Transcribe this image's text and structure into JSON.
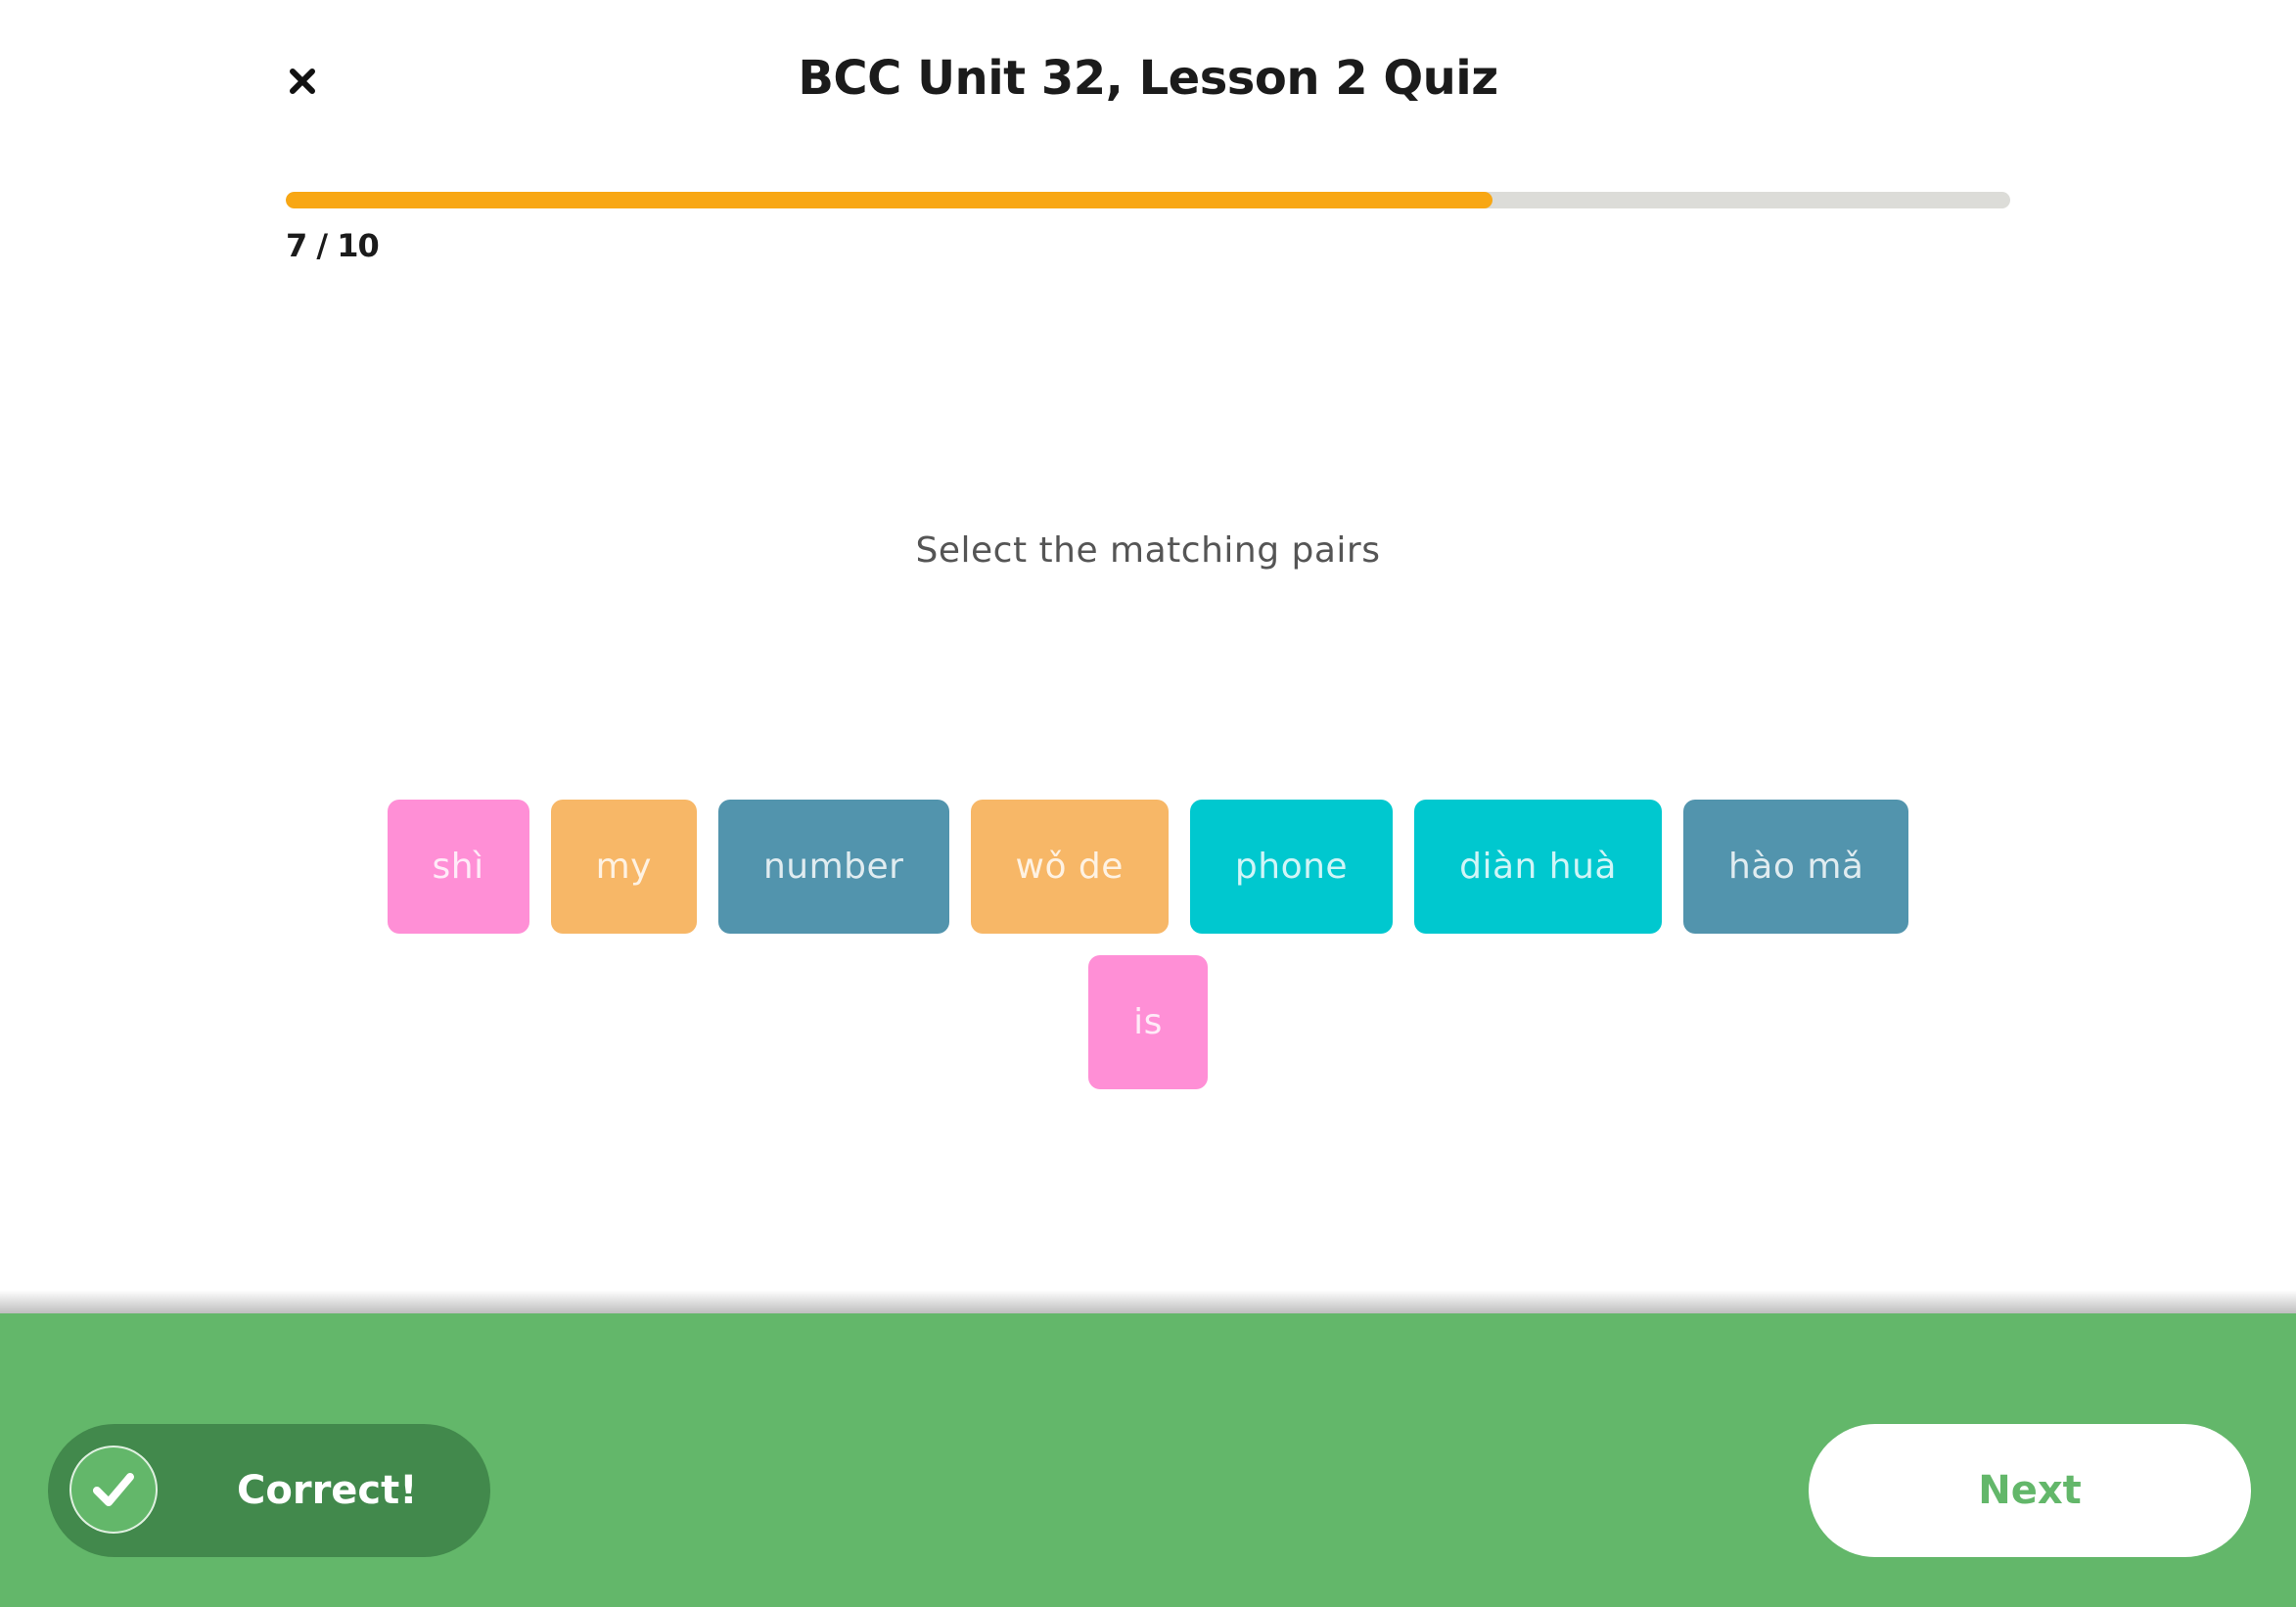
{
  "header": {
    "title": "BCC Unit 32, Lesson 2 Quiz",
    "close_icon": "close-icon"
  },
  "progress": {
    "current": 7,
    "total": 10,
    "fraction": 0.7,
    "label": "7 / 10",
    "fill_color": "#f8a714",
    "track_color": "#dcdcd8"
  },
  "question": {
    "instruction": "Select the matching pairs",
    "tiles": [
      {
        "label": "shì",
        "color": "pink",
        "pair": "is"
      },
      {
        "label": "my",
        "color": "orange",
        "pair": "wǒ de"
      },
      {
        "label": "number",
        "color": "slate",
        "pair": "hào mǎ"
      },
      {
        "label": "wǒ de",
        "color": "orange",
        "pair": "my"
      },
      {
        "label": "phone",
        "color": "cyan",
        "pair": "diàn huà"
      },
      {
        "label": "diàn huà",
        "color": "cyan",
        "pair": "phone"
      },
      {
        "label": "hào mǎ",
        "color": "slate",
        "pair": "number"
      },
      {
        "label": "is",
        "color": "pink",
        "pair": "shì"
      }
    ],
    "pair_colors": {
      "pink": "#ff8fd6",
      "orange": "#f7b767",
      "slate": "#5294ad",
      "cyan": "#00c8cf"
    }
  },
  "feedback": {
    "status": "Correct!",
    "icon": "check-circle-icon",
    "background_color": "#63b76a",
    "pill_color": "#42894c"
  },
  "actions": {
    "next_label": "Next"
  }
}
